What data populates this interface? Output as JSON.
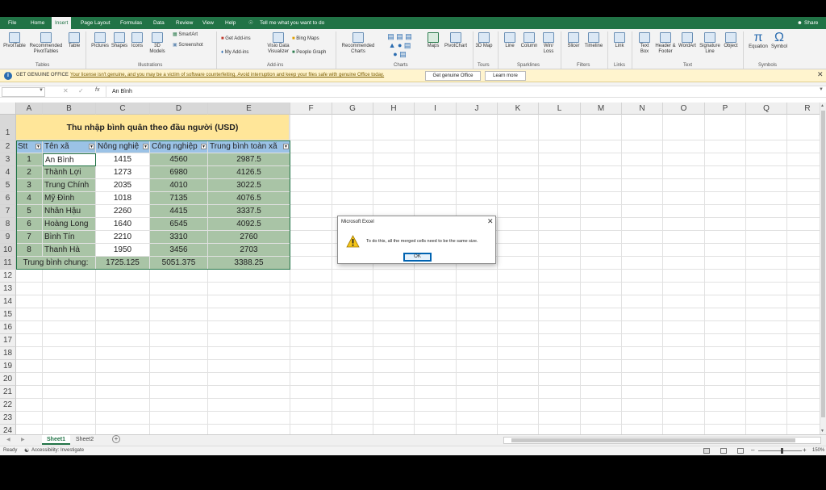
{
  "colors": {
    "accent": "#217346",
    "title_fill": "#ffe699",
    "header_fill": "#9bc2e6",
    "green_fill": "#a9c4a6",
    "message_bar": "#fff4ce"
  },
  "tabs": [
    "File",
    "Home",
    "Insert",
    "Page Layout",
    "Formulas",
    "Data",
    "Review",
    "View",
    "Help"
  ],
  "tell_me": "Tell me what you want to do",
  "share": "Share",
  "ribbon": {
    "pivottable": "PivotTable",
    "recommended_pivot": "Recommended PivotTables",
    "table": "Table",
    "tables_group": "Tables",
    "pictures": "Pictures",
    "shapes": "Shapes",
    "icons": "Icons",
    "models3d": "3D Models",
    "smartart": "SmartArt",
    "screenshot": "Screenshot",
    "illustrations_group": "Illustrations",
    "get_addins": "Get Add-ins",
    "my_addins": "My Add-ins",
    "visio": "Visio Data Visualizer",
    "bing_maps": "Bing Maps",
    "people_graph": "People Graph",
    "addins_group": "Add-ins",
    "recommended_charts": "Recommended Charts",
    "maps": "Maps",
    "pivotchart": "PivotChart",
    "charts_group": "Charts",
    "map3d": "3D Map",
    "tours_group": "Tours",
    "line": "Line",
    "column": "Column",
    "winloss": "Win/ Loss",
    "sparklines_group": "Sparklines",
    "slicer": "Slicer",
    "timeline": "Timeline",
    "filters_group": "Filters",
    "link": "Link",
    "links_group": "Links",
    "textbox": "Text Box",
    "header_footer": "Header & Footer",
    "wordart": "WordArt",
    "signature": "Signature Line",
    "object": "Object",
    "text_group": "Text",
    "equation": "Equation",
    "symbol": "Symbol",
    "symbols_group": "Symbols"
  },
  "message_bar": {
    "title": "GET GENUINE OFFICE",
    "text": "Your license isn't genuine, and you may be a victim of software counterfeiting. Avoid interruption and keep your files safe with genuine Office today.",
    "btn1": "Get genuine Office",
    "btn2": "Learn more"
  },
  "formula_bar": {
    "fx": "fx",
    "value": "An Bình"
  },
  "columns": [
    "A",
    "B",
    "C",
    "D",
    "E",
    "F",
    "G",
    "H",
    "I",
    "J",
    "K",
    "L",
    "M",
    "N",
    "O",
    "P",
    "Q",
    "R"
  ],
  "rows": [
    "1",
    "2",
    "3",
    "4",
    "5",
    "6",
    "7",
    "8",
    "9",
    "10",
    "11",
    "12",
    "13",
    "14",
    "15",
    "16",
    "17",
    "18",
    "19",
    "20",
    "21",
    "22",
    "23",
    "24"
  ],
  "sheet": {
    "title": "Thu nhập bình quân theo đầu người (USD)",
    "headers": [
      "Stt",
      "Tên xã",
      "Nông nghiệ",
      "Công nghiệp",
      "Trung bình toàn xã"
    ],
    "data": [
      [
        "1",
        "An Bình",
        "1415",
        "4560",
        "2987.5"
      ],
      [
        "2",
        "Thành Lợi",
        "1273",
        "6980",
        "4126.5"
      ],
      [
        "3",
        "Trung Chính",
        "2035",
        "4010",
        "3022.5"
      ],
      [
        "4",
        "Mỹ Đình",
        "1018",
        "7135",
        "4076.5"
      ],
      [
        "5",
        "Nhân Hậu",
        "2260",
        "4415",
        "3337.5"
      ],
      [
        "6",
        "Hoàng Long",
        "1640",
        "6545",
        "4092.5"
      ],
      [
        "7",
        "Bình Tín",
        "2210",
        "3310",
        "2760"
      ],
      [
        "8",
        "Thanh Hà",
        "1950",
        "3456",
        "2703"
      ]
    ],
    "total_label": "Trung bình chung:",
    "totals": [
      "1725.125",
      "5051.375",
      "3388.25"
    ]
  },
  "sheet_tabs": [
    "Sheet1",
    "Sheet2"
  ],
  "status": {
    "ready": "Ready",
    "accessibility": "Accessibility: Investigate",
    "zoom": "150%"
  },
  "dialog": {
    "title": "Microsoft Excel",
    "message": "To do this, all the merged cells need to be the same size.",
    "ok": "OK"
  }
}
